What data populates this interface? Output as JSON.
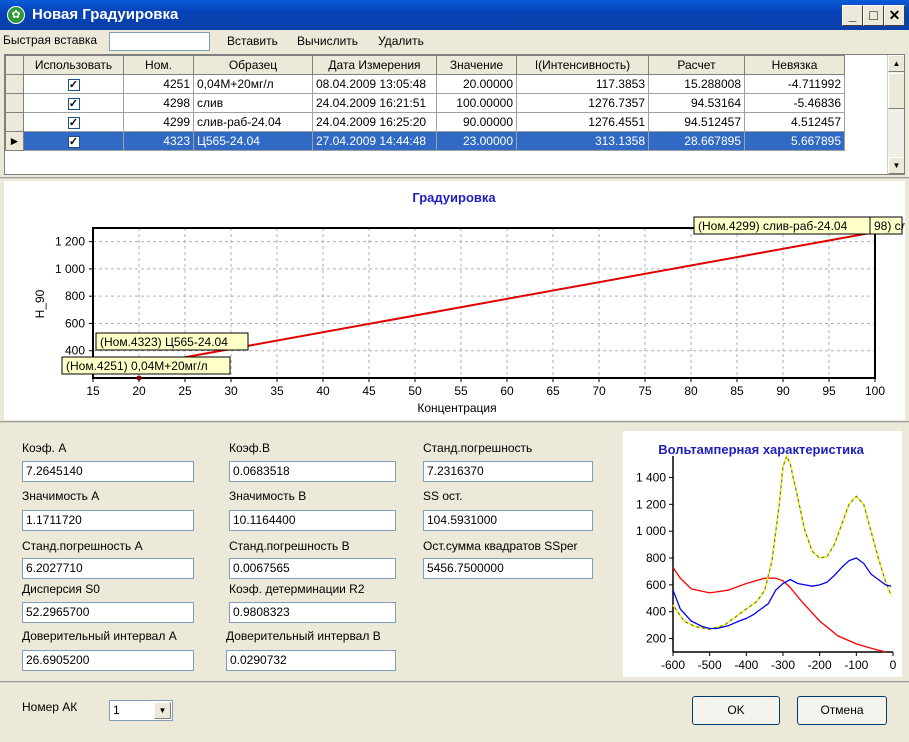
{
  "window": {
    "title": "Новая Градуировка"
  },
  "toolbar": {
    "quick_insert_label": "Быстрая вставка",
    "quick_insert_value": "",
    "insert": "Вставить",
    "calculate": "Вычислить",
    "delete": "Удалить"
  },
  "grid": {
    "columns": [
      "Использовать",
      "Ном.",
      "Образец",
      "Дата Измерения",
      "Значение",
      "I(Интенсивность)",
      "Расчет",
      "Невязка"
    ],
    "rows": [
      {
        "use": true,
        "num": "4251",
        "sample": "0,04М+20мг/л",
        "date": "08.04.2009 13:05:48",
        "value": "20.00000",
        "intensity": "117.3853",
        "calc": "15.288008",
        "residual": "-4.711992"
      },
      {
        "use": true,
        "num": "4298",
        "sample": "слив",
        "date": "24.04.2009 16:21:51",
        "value": "100.00000",
        "intensity": "1276.7357",
        "calc": "94.53164",
        "residual": "-5.46836"
      },
      {
        "use": true,
        "num": "4299",
        "sample": "слив-раб-24.04",
        "date": "24.04.2009 16:25:20",
        "value": "90.00000",
        "intensity": "1276.4551",
        "calc": "94.512457",
        "residual": "4.512457"
      },
      {
        "use": true,
        "num": "4323",
        "sample": "Ц565-24.04",
        "date": "27.04.2009 14:44:48",
        "value": "23.00000",
        "intensity": "313.1358",
        "calc": "28.667895",
        "residual": "5.667895",
        "selected": true
      }
    ]
  },
  "chart_data": [
    {
      "type": "scatter",
      "title": "Градуировка",
      "xlabel": "Концентрация",
      "ylabel": "H_90",
      "xlim": [
        15,
        100
      ],
      "ylim": [
        200,
        1300
      ],
      "xticks": [
        15,
        20,
        25,
        30,
        35,
        40,
        45,
        50,
        55,
        60,
        65,
        70,
        75,
        80,
        85,
        90,
        95,
        100
      ],
      "yticks": [
        400,
        600,
        800,
        1000,
        1200
      ],
      "ytick_labels": [
        "400",
        "600",
        "800",
        "1 000",
        "1 200"
      ],
      "grid": true,
      "points": [
        {
          "x": 20,
          "y": 117.4
        },
        {
          "x": 23,
          "y": 313.1
        },
        {
          "x": 90,
          "y": 1276.5
        },
        {
          "x": 100,
          "y": 1276.7
        }
      ],
      "fit_line": {
        "x": [
          15,
          100
        ],
        "y": [
          229.9,
          1269.8
        ],
        "color": "#e00000"
      },
      "annotations": [
        {
          "text": "(Ном.4299) слив-раб-24.04",
          "x": 90,
          "y": 1276.5
        },
        {
          "text": "98) сл",
          "x": 100,
          "y": 1276.7
        },
        {
          "text": "(Ном.4323) Ц565-24.04",
          "x": 23,
          "y": 313.1
        },
        {
          "text": "(Ном.4251) 0,04М+20мг/л",
          "x": 20,
          "y": 117.4
        }
      ]
    },
    {
      "type": "line",
      "title": "Вольтамперная характеристика",
      "xlim": [
        -600,
        0
      ],
      "ylim": [
        100,
        1560
      ],
      "xticks": [
        -600,
        -500,
        -400,
        -300,
        -200,
        -100,
        0
      ],
      "yticks": [
        200,
        400,
        600,
        800,
        1000,
        1200,
        1400
      ],
      "ytick_labels": [
        "200",
        "400",
        "600",
        "800",
        "1 000",
        "1 200",
        "1 400"
      ],
      "grid": false,
      "series": [
        {
          "color": "#ff0000",
          "x": [
            -600,
            -580,
            -550,
            -500,
            -450,
            -400,
            -350,
            -320,
            -300,
            -280,
            -250,
            -200,
            -150,
            -100,
            -50,
            -20
          ],
          "y": [
            730,
            650,
            570,
            540,
            560,
            610,
            650,
            650,
            630,
            580,
            480,
            330,
            220,
            160,
            120,
            100
          ]
        },
        {
          "color": "#808000",
          "x": [
            -600,
            -570,
            -540,
            -500,
            -460,
            -430,
            -400,
            -370,
            -350,
            -330,
            -310,
            -300,
            -290,
            -280,
            -260,
            -240,
            -220,
            -200,
            -180,
            -160,
            -140,
            -120,
            -100,
            -80,
            -60,
            -40,
            -20,
            -5
          ],
          "y": [
            450,
            330,
            290,
            270,
            300,
            360,
            420,
            480,
            560,
            780,
            1200,
            1480,
            1560,
            1500,
            1250,
            1000,
            850,
            800,
            810,
            900,
            1050,
            1200,
            1260,
            1200,
            1000,
            800,
            620,
            520
          ]
        },
        {
          "color": "#ffff00",
          "x": [
            -600,
            -570,
            -540,
            -500,
            -460,
            -430,
            -400,
            -370,
            -350,
            -330,
            -310,
            -300,
            -290,
            -280,
            -260,
            -240,
            -220,
            -200,
            -180,
            -160,
            -140,
            -120,
            -100,
            -80,
            -60,
            -40,
            -20,
            -5
          ],
          "y": [
            450,
            330,
            290,
            270,
            300,
            360,
            420,
            480,
            560,
            780,
            1200,
            1480,
            1560,
            1500,
            1250,
            1000,
            850,
            800,
            810,
            900,
            1050,
            1200,
            1260,
            1200,
            1000,
            800,
            620,
            520
          ]
        },
        {
          "color": "#0000ff",
          "x": [
            -600,
            -580,
            -550,
            -520,
            -500,
            -480,
            -450,
            -420,
            -400,
            -380,
            -360,
            -340,
            -320,
            -300,
            -280,
            -260,
            -240,
            -220,
            -200,
            -180,
            -160,
            -140,
            -120,
            -100,
            -80,
            -60,
            -40,
            -20,
            -5
          ],
          "y": [
            560,
            420,
            330,
            290,
            275,
            275,
            295,
            330,
            350,
            380,
            420,
            460,
            560,
            610,
            640,
            610,
            600,
            590,
            600,
            620,
            670,
            730,
            780,
            800,
            760,
            680,
            640,
            600,
            590
          ]
        }
      ]
    }
  ],
  "stats": {
    "coef_a_label": "Коэф. А",
    "coef_a": "7.2645140",
    "coef_b_label": "Коэф.В",
    "coef_b": "0.0683518",
    "std_err_label": "Станд.погрешность",
    "std_err": "7.2316370",
    "sig_a_label": "Значимость А",
    "sig_a": "1.1711720",
    "sig_b_label": "Значимость В",
    "sig_b": "10.1164400",
    "ss_res_label": "SS ост.",
    "ss_res": "104.5931000",
    "std_err_a_label": "Станд.погрешность А",
    "std_err_a": "6.2027710",
    "std_err_b_label": "Станд.погрешность В",
    "std_err_b": "0.0067565",
    "ss_per_label": "Ост.сумма квадратов SSper",
    "ss_per": "5456.7500000",
    "disp_label": "Дисперсия S0",
    "disp": "52.2965700",
    "r2_label": "Коэф. детерминации R2",
    "r2": "0.9808323",
    "ci_a_label": "Доверительный интервал А",
    "ci_a": "26.6905200",
    "ci_b_label": "Доверительный интервал В",
    "ci_b": "0.0290732"
  },
  "footer": {
    "ak_label": "Номер АК",
    "ak_value": "1",
    "ok": "OK",
    "cancel": "Отмена"
  }
}
